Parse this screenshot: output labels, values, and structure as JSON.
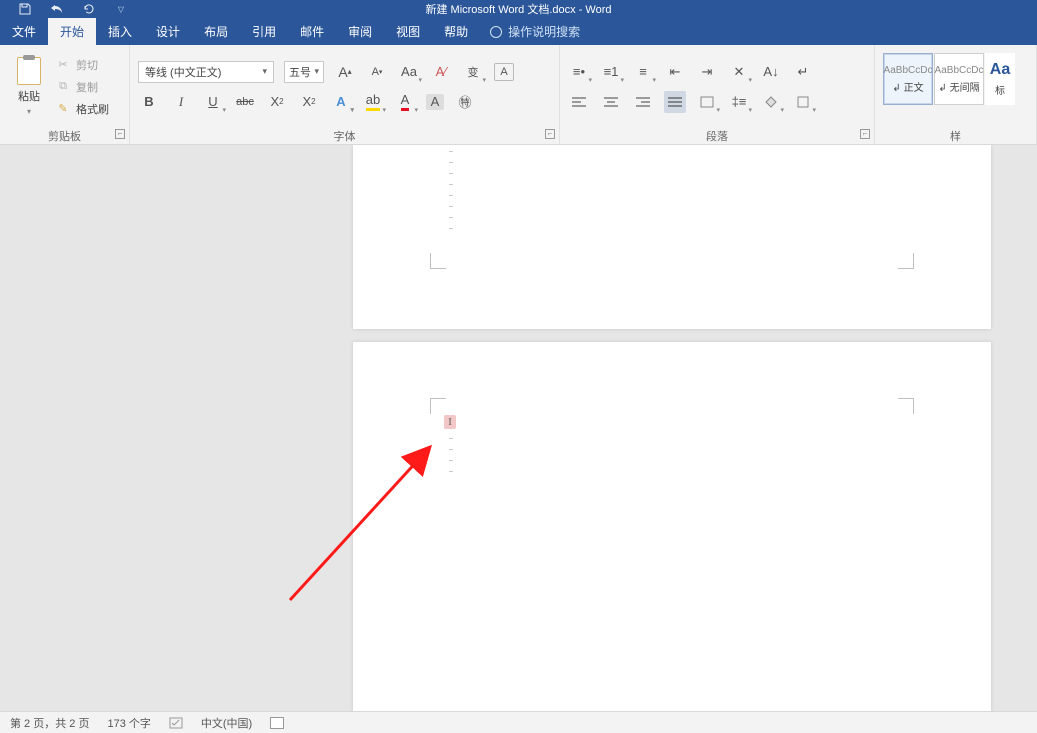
{
  "title": "新建 Microsoft Word 文档.docx  -  Word",
  "tabs": {
    "file": "文件",
    "home": "开始",
    "insert": "插入",
    "design": "设计",
    "layout": "布局",
    "references": "引用",
    "mailings": "邮件",
    "review": "审阅",
    "view": "视图",
    "help": "帮助",
    "tellme": "操作说明搜索"
  },
  "clipboard": {
    "paste": "粘贴",
    "cut": "剪切",
    "copy": "复制",
    "format_painter": "格式刷",
    "group_label": "剪贴板"
  },
  "font": {
    "name": "等线 (中文正文)",
    "size": "五号",
    "group_label": "字体"
  },
  "paragraph": {
    "group_label": "段落"
  },
  "styles": {
    "sample": "AaBbCcDc",
    "sample_big": "Aa",
    "normal": "正文",
    "no_spacing": "无间隔",
    "heading": "标",
    "group_label": "样"
  },
  "status": {
    "page": "第 2 页，共 2 页",
    "words": "173 个字",
    "language": "中文(中国)"
  }
}
